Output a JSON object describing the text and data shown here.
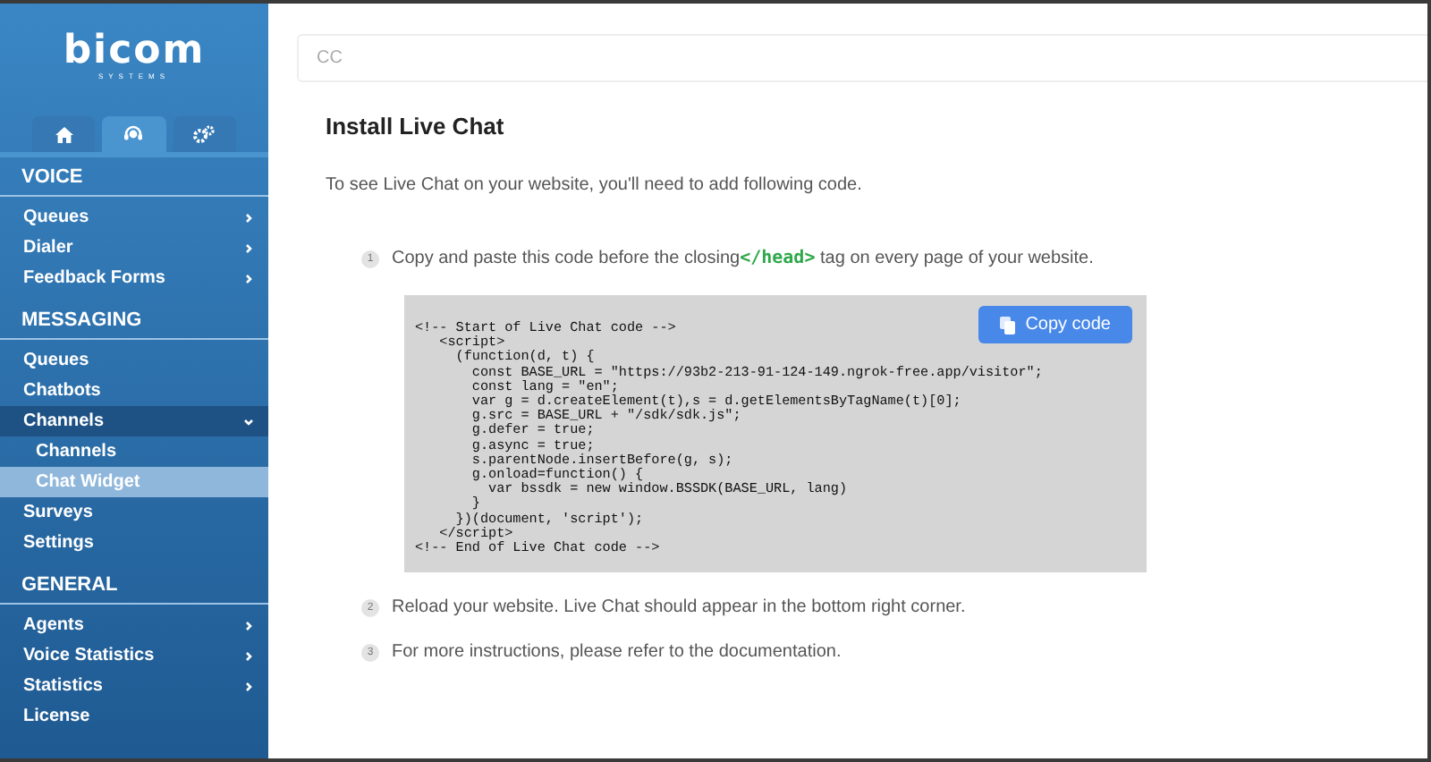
{
  "sidebar": {
    "logo": {
      "name": "bicom",
      "tagline": "SYSTEMS"
    },
    "tabs": [
      {
        "selected": false
      },
      {
        "selected": true
      },
      {
        "selected": false
      }
    ],
    "sections": [
      {
        "title": "VOICE",
        "items": [
          {
            "label": "Queues",
            "has_submenu": true,
            "selected": false
          },
          {
            "label": "Dialer",
            "has_submenu": true,
            "selected": false
          },
          {
            "label": "Feedback Forms",
            "has_submenu": true,
            "selected": false
          }
        ]
      },
      {
        "title": "MESSAGING",
        "items": [
          {
            "label": "Queues",
            "has_submenu": false,
            "selected": false
          },
          {
            "label": "Chatbots",
            "has_submenu": false,
            "selected": false
          },
          {
            "label": "Channels",
            "has_submenu": true,
            "expanded": true,
            "selected": false,
            "children": [
              {
                "label": "Channels",
                "selected": false
              },
              {
                "label": "Chat Widget",
                "selected": true
              }
            ]
          },
          {
            "label": "Surveys",
            "has_submenu": false,
            "selected": false
          },
          {
            "label": "Settings",
            "has_submenu": false,
            "selected": false
          }
        ]
      },
      {
        "title": "GENERAL",
        "items": [
          {
            "label": "Agents",
            "has_submenu": true,
            "selected": false
          },
          {
            "label": "Voice Statistics",
            "has_submenu": true,
            "selected": false
          },
          {
            "label": "Statistics",
            "has_submenu": true,
            "selected": false
          },
          {
            "label": "License",
            "has_submenu": false,
            "selected": false
          }
        ]
      }
    ]
  },
  "search": {
    "placeholder": "CC"
  },
  "title": "Install Live Chat",
  "intro": "To see Live Chat on your website, you'll need to add following code.",
  "steps": [
    {
      "number": "1",
      "text": "Copy and paste this code before the closing",
      "code": "</head>",
      "text_after": "tag on every page of your website."
    },
    {
      "number": "2",
      "text": "Reload your website. Live Chat should appear in the bottom right corner."
    },
    {
      "number": "3",
      "text": "For more instructions, please refer to the documentation."
    }
  ],
  "code_block": {
    "button": "Copy code",
    "lines": [
      "<!-- Start of Live Chat code -->",
      "   <script>",
      "     (function(d, t) {",
      "       const BASE_URL = \"https://93b2-213-91-124-149.ngrok-free.app/visitor\";",
      "       const lang = \"en\";",
      "       var g = d.createElement(t),s = d.getElementsByTagName(t)[0];",
      "       g.src = BASE_URL + \"/sdk/sdk.js\";",
      "       g.defer = true;",
      "       g.async = true;",
      "       s.parentNode.insertBefore(g, s);",
      "       g.onload=function() {",
      "         var bssdk = new window.BSSDK(BASE_URL, lang)",
      "       }",
      "     })(document, 'script');",
      "   </script>",
      "<!-- End of Live Chat code -->"
    ]
  }
}
